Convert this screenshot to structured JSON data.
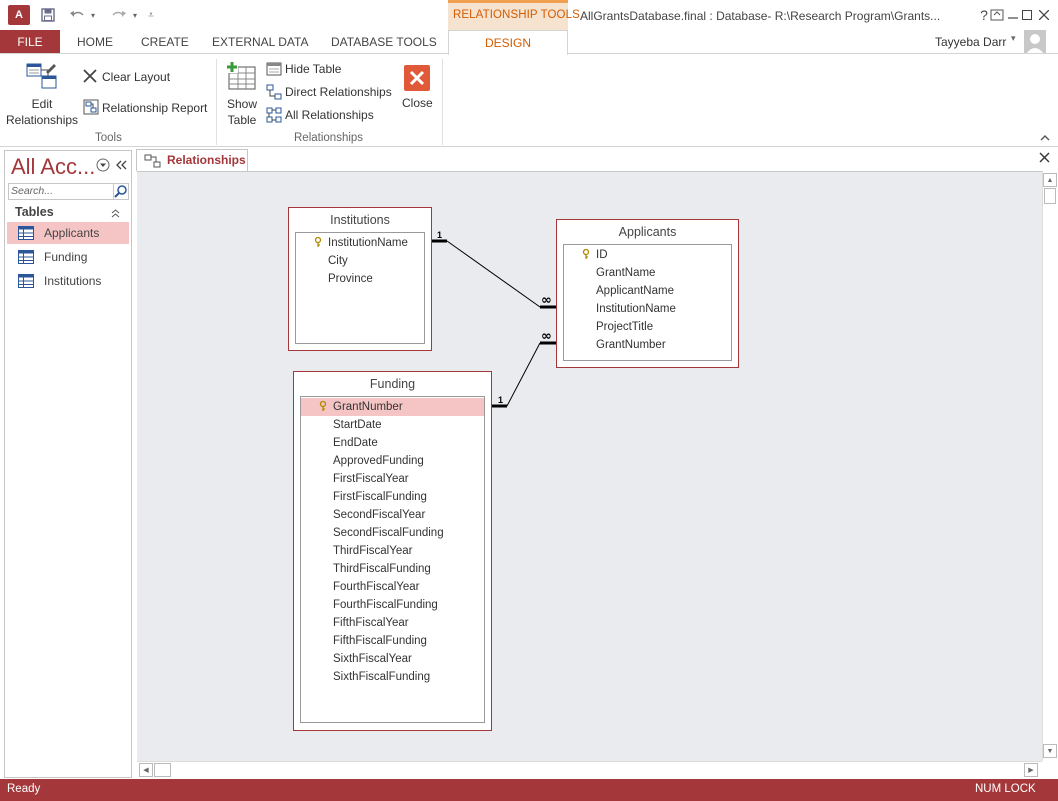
{
  "app": {
    "window_title": "AllGrantsDatabase.final : Database- R:\\Research Program\\Grants...",
    "logo_text": "A",
    "context_tab_group": "RELATIONSHIP TOOLS",
    "user_name": "Tayyeba Darr",
    "help_label": "?"
  },
  "tabs": [
    {
      "label": "FILE"
    },
    {
      "label": "HOME"
    },
    {
      "label": "CREATE"
    },
    {
      "label": "EXTERNAL DATA"
    },
    {
      "label": "DATABASE TOOLS"
    },
    {
      "label": "DESIGN"
    }
  ],
  "ribbon": {
    "tools_group": {
      "label": "Tools",
      "edit_relationships": "Edit\nRelationships",
      "clear_layout": "Clear Layout",
      "relationship_report": "Relationship Report"
    },
    "relationships_group": {
      "label": "Relationships",
      "show_table": "Show\nTable",
      "hide_table": "Hide Table",
      "direct_relationships": "Direct Relationships",
      "all_relationships": "All Relationships",
      "close": "Close"
    }
  },
  "nav_pane": {
    "title": "All Acc...",
    "search_placeholder": "Search...",
    "section": "Tables",
    "items": [
      {
        "label": "Applicants",
        "selected": true
      },
      {
        "label": "Funding",
        "selected": false
      },
      {
        "label": "Institutions",
        "selected": false
      }
    ]
  },
  "document": {
    "tab_label": "Relationships"
  },
  "tables": {
    "institutions": {
      "title": "Institutions",
      "key_field": "InstitutionName",
      "fields": [
        "InstitutionName",
        "City",
        "Province"
      ]
    },
    "applicants": {
      "title": "Applicants",
      "key_field": "ID",
      "fields": [
        "ID",
        "GrantName",
        "ApplicantName",
        "InstitutionName",
        "ProjectTitle",
        "GrantNumber"
      ]
    },
    "funding": {
      "title": "Funding",
      "key_field": "GrantNumber",
      "fields": [
        "GrantNumber",
        "StartDate",
        "EndDate",
        "ApprovedFunding",
        "FirstFiscalYear",
        "FirstFiscalFunding",
        "SecondFiscalYear",
        "SecondFiscalFunding",
        "ThirdFiscalYear",
        "ThirdFiscalFunding",
        "FourthFiscalYear",
        "FourthFiscalFunding",
        "FifthFiscalYear",
        "FifthFiscalFunding",
        "SixthFiscalYear",
        "SixthFiscalFunding"
      ]
    }
  },
  "relationships": [
    {
      "from": "Institutions.InstitutionName",
      "to": "Applicants.InstitutionName",
      "one_label": "1",
      "many_label": "∞"
    },
    {
      "from": "Funding.GrantNumber",
      "to": "Applicants.GrantNumber",
      "one_label": "1",
      "many_label": "∞"
    }
  ],
  "status": {
    "text": "Ready",
    "num_lock": "NUM LOCK"
  },
  "colors": {
    "accent": "#a4373a",
    "context_orange": "#d35b00",
    "selection": "#f5c5c5",
    "canvas": "#e9ebee"
  }
}
